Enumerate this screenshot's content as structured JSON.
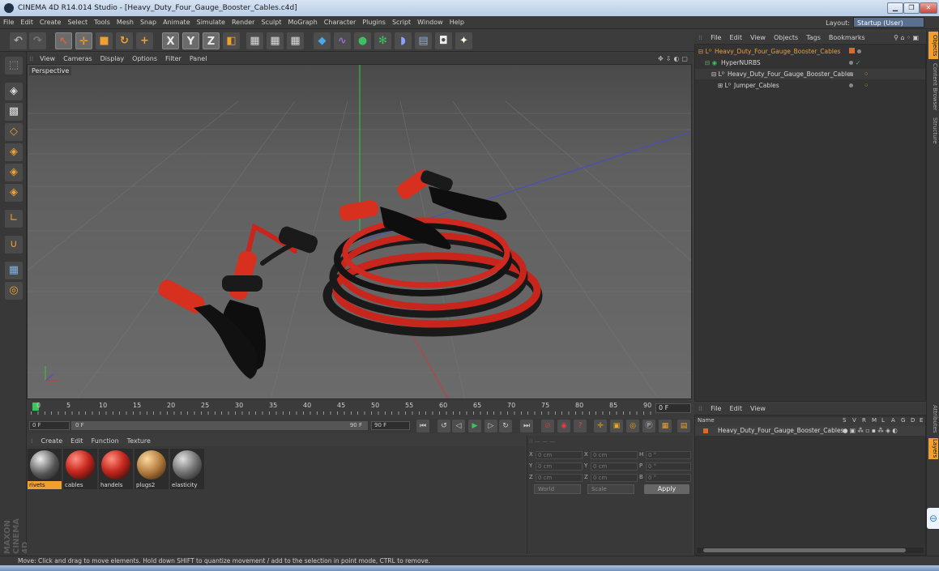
{
  "window": {
    "title": "CINEMA 4D R14.014 Studio - [Heavy_Duty_Four_Gauge_Booster_Cables.c4d]",
    "buttons": [
      "▁",
      "❐",
      "✕"
    ]
  },
  "menu": [
    "File",
    "Edit",
    "Create",
    "Select",
    "Tools",
    "Mesh",
    "Snap",
    "Animate",
    "Simulate",
    "Render",
    "Sculpt",
    "MoGraph",
    "Character",
    "Plugins",
    "Script",
    "Window",
    "Help"
  ],
  "layout": {
    "label": "Layout:",
    "value": "Startup (User)"
  },
  "toolbar_icons": [
    "undo-icon",
    "redo-icon",
    "select-icon",
    "move-icon",
    "scale-icon",
    "rotate-icon",
    "add-icon",
    "x-axis-icon",
    "y-axis-icon",
    "z-axis-icon",
    "coordinate-system-icon",
    "render-view-icon",
    "render-picture-viewer-icon",
    "render-settings-icon",
    "cube-icon",
    "spline-icon",
    "nurbs-icon",
    "array-icon",
    "deformer-icon",
    "floor-icon",
    "camera-icon",
    "light-icon"
  ],
  "viewport": {
    "menu": [
      "View",
      "Cameras",
      "Display",
      "Options",
      "Filter",
      "Panel"
    ],
    "label": "Perspective"
  },
  "timeline": {
    "ticks": [
      "0",
      "5",
      "10",
      "15",
      "20",
      "25",
      "30",
      "35",
      "40",
      "45",
      "50",
      "55",
      "60",
      "65",
      "70",
      "75",
      "80",
      "85",
      "90"
    ],
    "current_frame": "0 F",
    "start_field": "0 F",
    "range_start": "0 F",
    "range_end": "90 F",
    "end_field": "90 F"
  },
  "materials": {
    "menu": [
      "Create",
      "Edit",
      "Function",
      "Texture"
    ],
    "items": [
      {
        "name": "rivets",
        "color": "#9a9a9a"
      },
      {
        "name": "cables",
        "color": "#c8281e"
      },
      {
        "name": "handels",
        "color": "#c8281e"
      },
      {
        "name": "plugs2",
        "color": "#b07a3c"
      },
      {
        "name": "elasticity",
        "color": "#8a8a8a"
      }
    ]
  },
  "coordinates": {
    "rows": [
      {
        "a": "X",
        "av": "0 cm",
        "b": "X",
        "bv": "0 cm",
        "c": "H",
        "cv": "0 °"
      },
      {
        "a": "Y",
        "av": "0 cm",
        "b": "Y",
        "bv": "0 cm",
        "c": "P",
        "cv": "0 °"
      },
      {
        "a": "Z",
        "av": "0 cm",
        "b": "Z",
        "bv": "0 cm",
        "c": "B",
        "cv": "0 °"
      }
    ],
    "mode1": "World",
    "mode2": "Scale",
    "apply": "Apply"
  },
  "object_manager": {
    "menu": [
      "File",
      "Edit",
      "View",
      "Objects",
      "Tags",
      "Bookmarks"
    ],
    "objects": [
      {
        "name": "Heavy_Duty_Four_Gauge_Booster_Cables",
        "indent": 0
      },
      {
        "name": "HyperNURBS",
        "indent": 1
      },
      {
        "name": "Heavy_Duty_Four_Gauge_Booster_Cables",
        "indent": 2
      },
      {
        "name": "Jumper_Cables",
        "indent": 3
      }
    ]
  },
  "layer_manager": {
    "menu": [
      "File",
      "Edit",
      "View"
    ],
    "columns": [
      "Name",
      "S",
      "V",
      "R",
      "M",
      "L",
      "A",
      "G",
      "D",
      "E"
    ],
    "row": "Heavy_Duty_Four_Gauge_Booster_Cables"
  },
  "side_tabs": [
    "Objects",
    "Content Browser",
    "Structure",
    "Attributes",
    "Layers"
  ],
  "brand": "MAXON CINEMA 4D",
  "status": "Move: Click and drag to move elements. Hold down SHIFT to quantize movement / add to the selection in point mode, CTRL to remove."
}
